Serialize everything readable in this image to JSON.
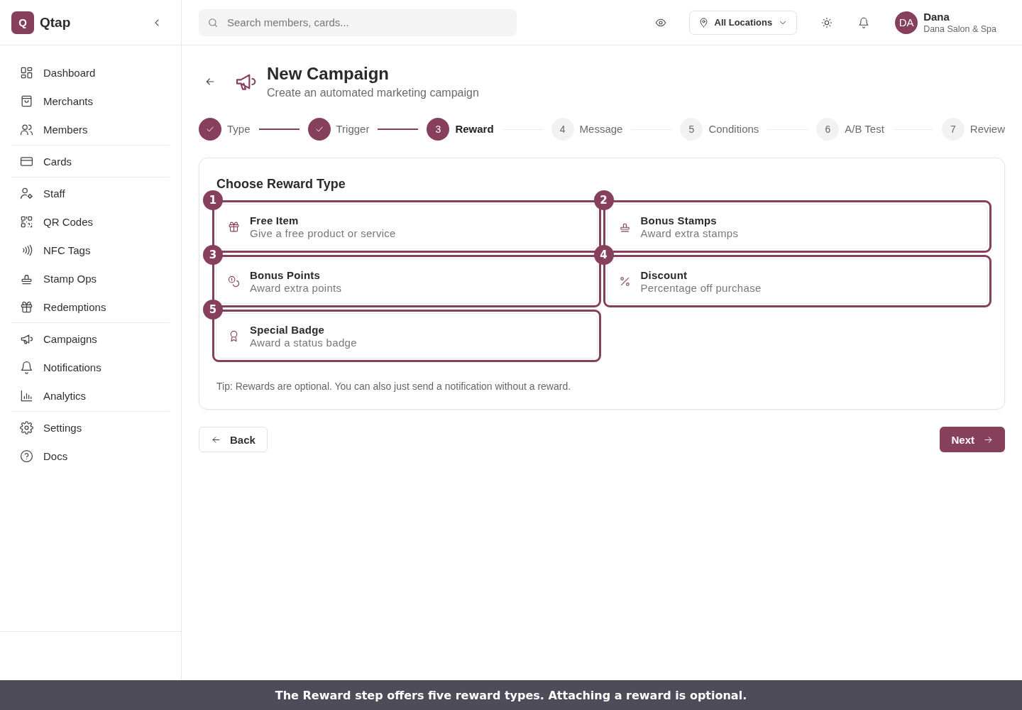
{
  "sidebar": {
    "logo_letter": "Q",
    "brand": "Qtap",
    "groups": [
      [
        {
          "label": "Dashboard"
        },
        {
          "label": "Merchants"
        },
        {
          "label": "Members"
        }
      ],
      [
        {
          "label": "Cards"
        }
      ],
      [
        {
          "label": "Staff"
        },
        {
          "label": "QR Codes"
        },
        {
          "label": "NFC Tags"
        },
        {
          "label": "Stamp Ops"
        },
        {
          "label": "Redemptions"
        }
      ],
      [
        {
          "label": "Campaigns"
        },
        {
          "label": "Notifications"
        },
        {
          "label": "Analytics"
        }
      ],
      [
        {
          "label": "Settings"
        },
        {
          "label": "Docs"
        }
      ]
    ]
  },
  "topbar": {
    "search": {
      "placeholder": "Search members, cards..."
    },
    "location": "All Locations",
    "user": {
      "initials": "DA",
      "name": "Dana",
      "business": "Dana Salon & Spa"
    }
  },
  "header": {
    "title": "New Campaign",
    "subtitle": "Create an automated marketing campaign"
  },
  "steps": [
    {
      "label": "Type",
      "completed": true,
      "selected": false
    },
    {
      "label": "Trigger",
      "completed": true,
      "selected": false
    },
    {
      "number": "3",
      "label": "Reward",
      "completed": false,
      "selected": true
    },
    {
      "number": "4",
      "label": "Message",
      "completed": false,
      "selected": false
    },
    {
      "number": "5",
      "label": "Conditions",
      "completed": false,
      "selected": false
    },
    {
      "number": "6",
      "label": "A/B Test",
      "completed": false,
      "selected": false
    },
    {
      "number": "7",
      "label": "Review",
      "completed": false,
      "selected": false
    }
  ],
  "reward_panel": {
    "title": "Choose Reward Type",
    "options": [
      {
        "marker": "1",
        "title": "Free Item",
        "description": "Give a free product or service"
      },
      {
        "marker": "2",
        "title": "Bonus Stamps",
        "description": "Award extra stamps"
      },
      {
        "marker": "3",
        "title": "Bonus Points",
        "description": "Award extra points"
      },
      {
        "marker": "4",
        "title": "Discount",
        "description": "Percentage off purchase"
      },
      {
        "marker": "5",
        "title": "Special Badge",
        "description": "Award a status badge"
      }
    ],
    "tip": "Tip: Rewards are optional. You can also just send a notification without a reward."
  },
  "footer": {
    "back": "Back",
    "next": "Next"
  },
  "caption": "The Reward step offers five reward types. Attaching a reward is optional."
}
